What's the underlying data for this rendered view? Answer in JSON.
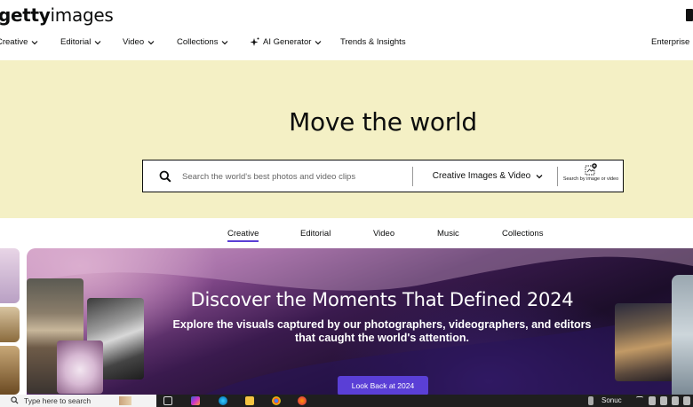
{
  "header": {
    "logo_bold": "getty",
    "logo_thin": "images",
    "nav": [
      {
        "label": "Creative",
        "has_chevron": true
      },
      {
        "label": "Editorial",
        "has_chevron": true
      },
      {
        "label": "Video",
        "has_chevron": true
      },
      {
        "label": "Collections",
        "has_chevron": true
      },
      {
        "label": "AI Generator",
        "has_chevron": true,
        "icon": "sparkle-icon"
      },
      {
        "label": "Trends & Insights",
        "has_chevron": false
      },
      {
        "label": "Enterprise",
        "has_chevron": true
      }
    ]
  },
  "hero": {
    "title": "Move the world",
    "search": {
      "placeholder": "Search the world's best photos and video clips",
      "type_selected": "Creative Images & Video",
      "by_image_label": "Search by image or video"
    }
  },
  "tabs": [
    {
      "label": "Creative",
      "active": true
    },
    {
      "label": "Editorial",
      "active": false
    },
    {
      "label": "Video",
      "active": false
    },
    {
      "label": "Music",
      "active": false
    },
    {
      "label": "Collections",
      "active": false
    }
  ],
  "banner": {
    "title": "Discover the Moments That Defined 2024",
    "subtitle": "Explore the visuals captured by our photographers, videographers, and editors that caught the world's attention.",
    "cta": "Look Back at 2024"
  },
  "taskbar": {
    "search_placeholder": "Type here to search",
    "tray_text": "Sonuc"
  },
  "colors": {
    "hero_bg": "#f4f0c5",
    "accent": "#5a3fd6",
    "text": "#0c0d0d"
  }
}
